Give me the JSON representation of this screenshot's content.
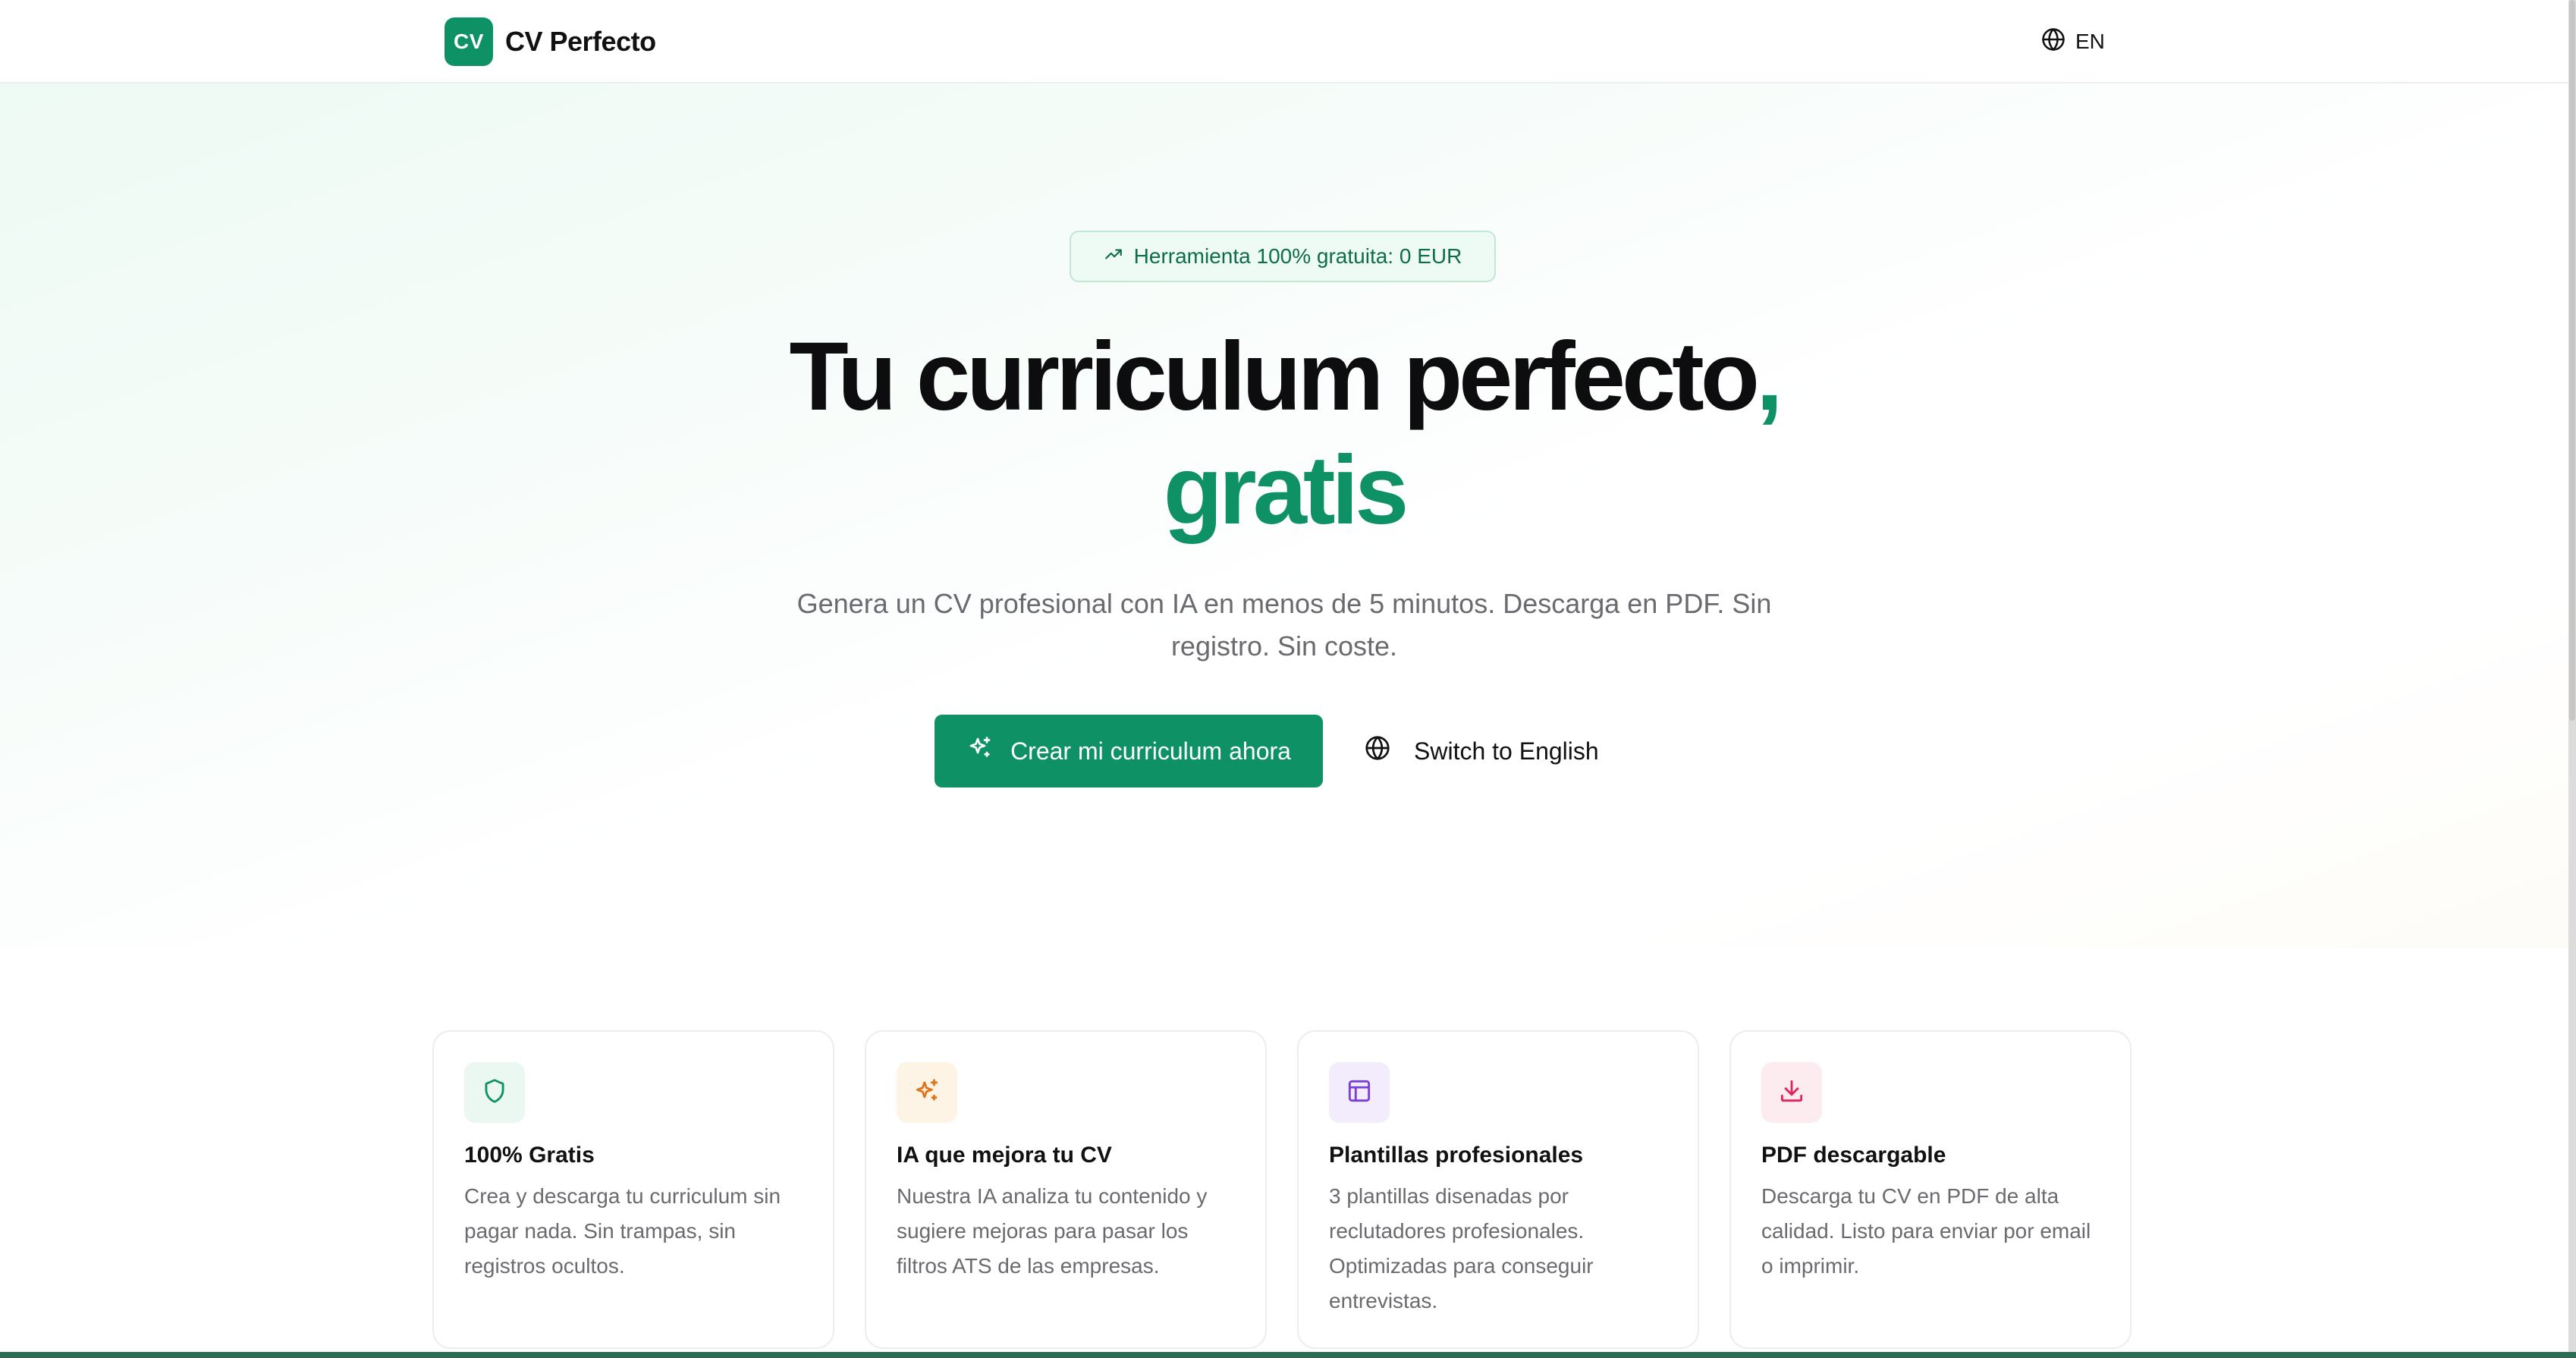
{
  "header": {
    "logo_mark": "CV",
    "logo_text": "CV Perfecto",
    "lang_label": "EN"
  },
  "hero": {
    "badge": "Herramienta 100% gratuita: 0 EUR",
    "title_main": "Tu curriculum perfecto",
    "title_comma": ",",
    "title_accent": "gratis",
    "subtitle": "Genera un CV profesional con IA en menos de 5 minutos. Descarga en PDF. Sin registro. Sin coste.",
    "cta_primary": "Crear mi curriculum ahora",
    "cta_secondary": "Switch to English"
  },
  "features": [
    {
      "title": "100% Gratis",
      "desc": "Crea y descarga tu curriculum sin pagar nada. Sin trampas, sin registros ocultos.",
      "icon": "shield-icon",
      "bg": "#eaf8f1",
      "color": "#0e9265"
    },
    {
      "title": "IA que mejora tu CV",
      "desc": "Nuestra IA analiza tu contenido y sugiere mejoras para pasar los filtros ATS de las empresas.",
      "icon": "sparkles-icon",
      "bg": "#fdf4e6",
      "color": "#e0741a"
    },
    {
      "title": "Plantillas profesionales",
      "desc": "3 plantillas disenadas por reclutadores profesionales. Optimizadas para conseguir entrevistas.",
      "icon": "layout-icon",
      "bg": "#f2ecfd",
      "color": "#7a3fd6"
    },
    {
      "title": "PDF descargable",
      "desc": "Descarga tu CV en PDF de alta calidad. Listo para enviar por email o imprimir.",
      "icon": "download-icon",
      "bg": "#fdecef",
      "color": "#e0245e"
    }
  ],
  "colors": {
    "brand": "#0e9265",
    "text": "#0d0d0f",
    "muted": "#6a6a70"
  }
}
